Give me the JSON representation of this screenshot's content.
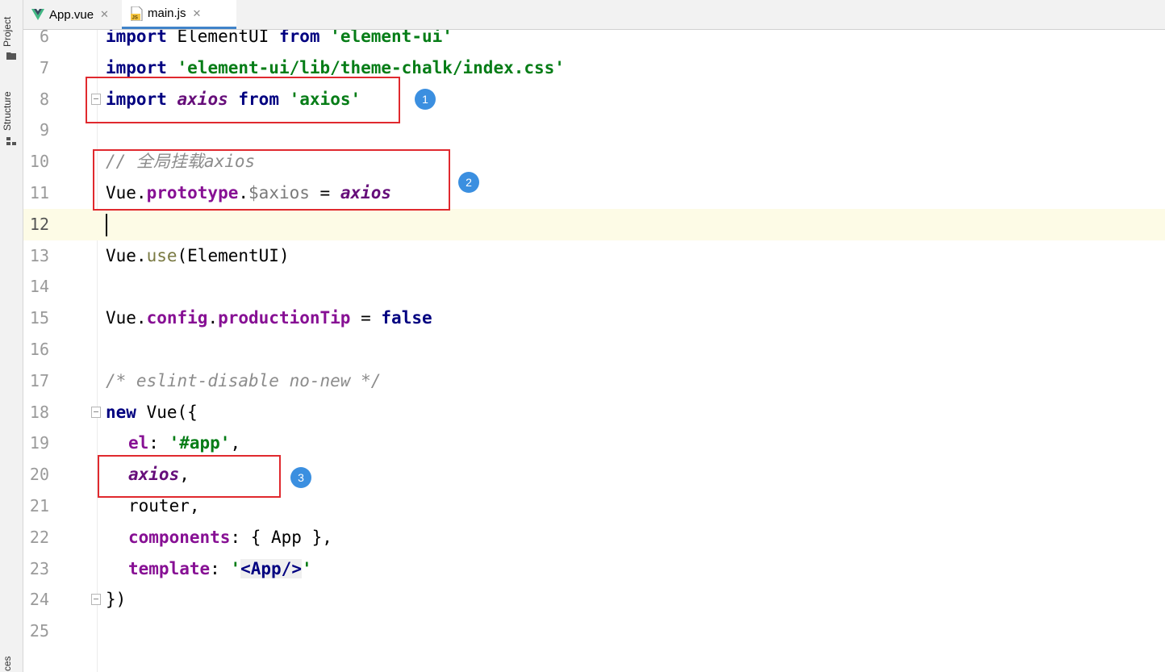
{
  "sidebar": {
    "project_label": "Project",
    "structure_label": "Structure",
    "bottom_label": "ces"
  },
  "tabs": [
    {
      "label": "App.vue",
      "icon": "vue-icon",
      "active": false
    },
    {
      "label": "main.js",
      "icon": "js-file-icon",
      "active": true
    }
  ],
  "editor": {
    "current_line": 12,
    "lines": [
      {
        "num": "6"
      },
      {
        "num": "7"
      },
      {
        "num": "8"
      },
      {
        "num": "9"
      },
      {
        "num": "10"
      },
      {
        "num": "11"
      },
      {
        "num": "12"
      },
      {
        "num": "13"
      },
      {
        "num": "14"
      },
      {
        "num": "15"
      },
      {
        "num": "16"
      },
      {
        "num": "17"
      },
      {
        "num": "18"
      },
      {
        "num": "19"
      },
      {
        "num": "20"
      },
      {
        "num": "21"
      },
      {
        "num": "22"
      },
      {
        "num": "23"
      },
      {
        "num": "24"
      },
      {
        "num": "25"
      }
    ],
    "tokens": {
      "l6_import": "import",
      "l6_name": " ElementUI ",
      "l6_from": "from",
      "l6_str": "'element-ui'",
      "l7_import": "import",
      "l7_str": "'element-ui/lib/theme-chalk/index.css'",
      "l8_import": "import",
      "l8_var": "axios",
      "l8_from": "from",
      "l8_str": "'axios'",
      "l10_comment": "// 全局挂载axios",
      "l11_obj": "Vue.",
      "l11_prop": "prototype",
      "l11_dot": ".",
      "l11_member": "$axios",
      "l11_eq": " = ",
      "l11_var": "axios",
      "l13_obj": "Vue.",
      "l13_meth": "use",
      "l13_args": "(ElementUI)",
      "l15_obj": "Vue.",
      "l15_prop1": "config",
      "l15_dot": ".",
      "l15_prop2": "productionTip",
      "l15_eq": " = ",
      "l15_kw": "false",
      "l17_comment": "/* eslint-disable no-new */",
      "l18_kw": "new",
      "l18_rest": " Vue({",
      "l19_prop": "el",
      "l19_colon": ": ",
      "l19_str": "'#app'",
      "l19_comma": ",",
      "l20_var": "axios",
      "l20_comma": ",",
      "l21_text": "router,",
      "l22_prop": "components",
      "l22_rest": ": { App },",
      "l23_prop": "template",
      "l23_colon": ": ",
      "l23_q1": "'",
      "l23_tag": "<App/>",
      "l23_q2": "'",
      "l24_text": "})"
    }
  },
  "annotations": [
    {
      "badge": "1"
    },
    {
      "badge": "2"
    },
    {
      "badge": "3"
    }
  ],
  "colors": {
    "keyword": "#000080",
    "string": "#067d17",
    "variable": "#660e7a",
    "property": "#871094",
    "comment": "#8c8c8c",
    "annotation_box": "#e0292e",
    "badge": "#3b8fe0",
    "current_line": "#fdfbe6"
  }
}
